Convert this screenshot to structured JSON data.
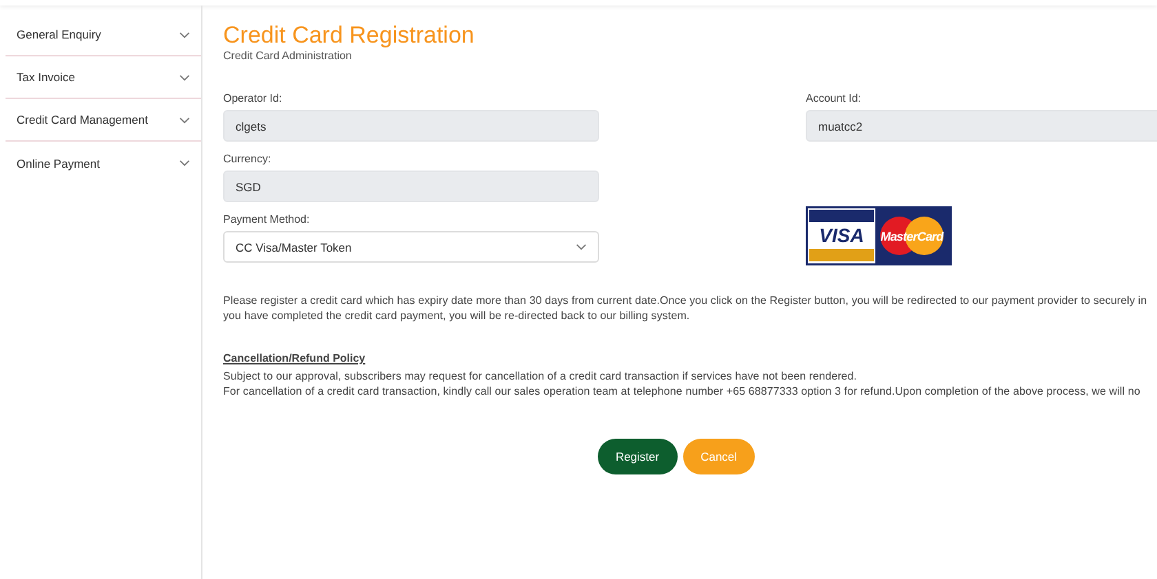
{
  "sidebar": {
    "items": [
      {
        "label": "General Enquiry",
        "expanded": false
      },
      {
        "label": "Tax Invoice",
        "expanded": false
      },
      {
        "label": "Credit Card Management",
        "expanded": false
      },
      {
        "label": "Online Payment",
        "expanded": false
      }
    ]
  },
  "page": {
    "title": "Credit Card Registration",
    "subtitle": "Credit Card Administration"
  },
  "form": {
    "left_fields": [
      {
        "kind": "text",
        "label": "Operator Id:",
        "value": "clgets",
        "readonly": true
      },
      {
        "kind": "text",
        "label": "Currency:",
        "value": "SGD",
        "readonly": true
      },
      {
        "kind": "select",
        "label": "Payment Method:",
        "value": "CC Visa/Master Token",
        "readonly": false
      }
    ],
    "right_fields": [
      {
        "kind": "text",
        "label": "Account Id:",
        "value": "muatcc2",
        "readonly": true
      }
    ]
  },
  "card_logos": [
    {
      "label": "VISA"
    },
    {
      "label": "MasterCard"
    }
  ],
  "notice": {
    "lines": [
      "Please register a credit card which has expiry date more than 30 days from current date.Once you click on the Register button, you will be redirected to our payment provider to securely in",
      "you have completed the credit card payment, you will be re-directed back to our billing system."
    ]
  },
  "policy": {
    "heading": "Cancellation/Refund Policy",
    "lines": [
      "Subject to our approval, subscribers may request for cancellation of a credit card transaction if services have not been rendered.",
      "For cancellation of a credit card transaction, kindly call our sales operation team at telephone number +65 68877333 option 3 for refund.Upon completion of the above process, we will no"
    ]
  },
  "buttons": [
    {
      "label": "Register",
      "kind": "primary"
    },
    {
      "label": "Cancel",
      "kind": "secondary"
    }
  ]
}
